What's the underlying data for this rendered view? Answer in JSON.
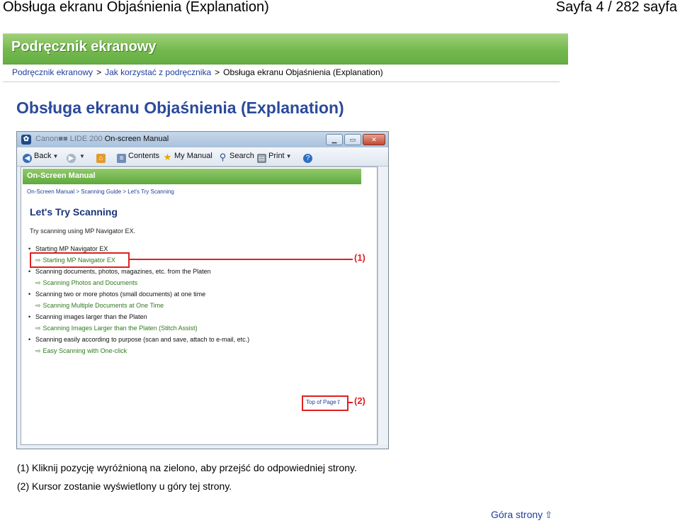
{
  "document_title": "Obsługa ekranu Objaśnienia (Explanation)",
  "page_counter": "Sayfa 4 / 282 sayfa",
  "banner_title": "Podręcznik ekranowy",
  "breadcrumb": {
    "items": [
      "Podręcznik ekranowy",
      "Jak korzystać z podręcznika"
    ],
    "separator": ">",
    "current": "Obsługa ekranu Objaśnienia (Explanation)"
  },
  "page_title": "Obsługa ekranu Objaśnienia (Explanation)",
  "screenshot": {
    "window_title": "On-screen Manual",
    "window_title_blurred": "Canon■■ LIDE 200",
    "toolbar": {
      "back": "Back",
      "contents": "Contents",
      "my_manual": "My Manual",
      "search": "Search",
      "print": "Print"
    },
    "banner": "On-Screen Manual",
    "breadcrumb": "On-Screen Manual > Scanning Guide > Let's Try Scanning",
    "heading": "Let's Try Scanning",
    "lead": "Try scanning using MP Navigator EX.",
    "list": [
      {
        "kind": "bullet",
        "text": "Starting MP Navigator EX"
      },
      {
        "kind": "link",
        "text": "Starting MP Navigator EX"
      },
      {
        "kind": "bullet",
        "text": "Scanning documents, photos, magazines, etc. from the Platen"
      },
      {
        "kind": "link",
        "text": "Scanning Photos and Documents"
      },
      {
        "kind": "bullet",
        "text": "Scanning two or more photos (small documents) at one time"
      },
      {
        "kind": "link",
        "text": "Scanning Multiple Documents at One Time"
      },
      {
        "kind": "bullet",
        "text": "Scanning images larger than the Platen"
      },
      {
        "kind": "link",
        "text": "Scanning Images Larger than the Platen (Stitch Assist)"
      },
      {
        "kind": "bullet",
        "text": "Scanning easily according to purpose (scan and save, attach to e-mail, etc.)"
      },
      {
        "kind": "link",
        "text": "Easy Scanning with One-click"
      }
    ],
    "top_of_page": "Top of Page",
    "callout_1": "(1)",
    "callout_2": "(2)",
    "highlight_color": "#e02020"
  },
  "notes": [
    "(1) Kliknij pozycję wyróżnioną na zielono, aby przejść do odpowiedniej strony.",
    "(2) Kursor zostanie wyświetlony u góry tej strony."
  ],
  "top_link": "Góra strony",
  "colors": {
    "banner_green": "#73b84d",
    "title_blue": "#2b4a9c",
    "link_blue": "#1f3f9a"
  }
}
